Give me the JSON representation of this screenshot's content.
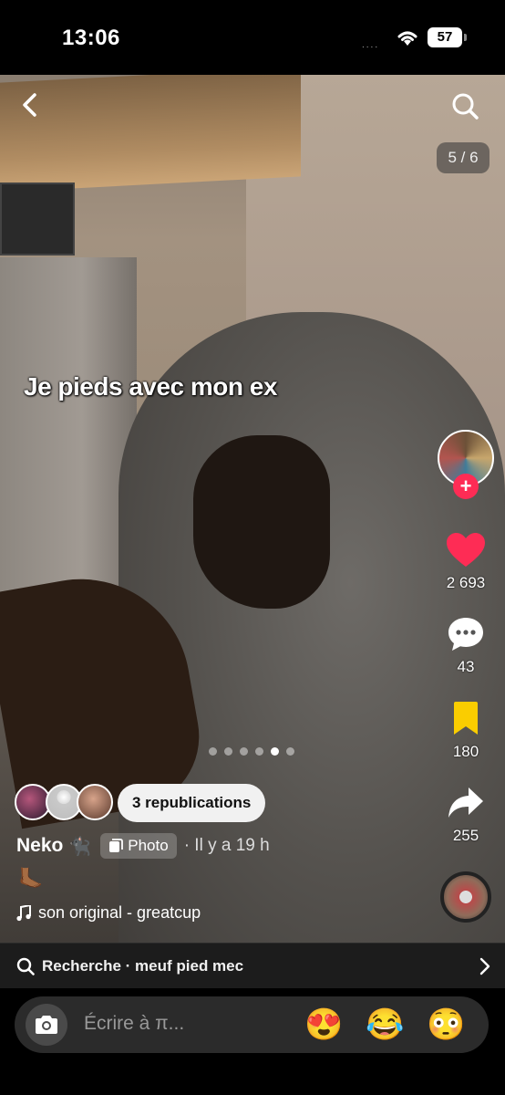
{
  "status_bar": {
    "time": "13:06",
    "signal": "....",
    "battery": "57"
  },
  "post": {
    "caption": "Je pieds avec mon ex",
    "counter": "5 / 6",
    "slides": {
      "total": 6,
      "active": 5
    }
  },
  "actions": {
    "likes": "2 693",
    "comments": "43",
    "saves": "180",
    "shares": "255",
    "like_color": "#fe2c55",
    "save_color": "#facd00",
    "follow_color": "#fe2c55"
  },
  "reposts": {
    "label": "3 republications"
  },
  "author": {
    "name": "Neko",
    "emoji": "🐈‍⬛",
    "badge": "Photo",
    "time": "· Il y a 19 h",
    "bio_emoji": "🦶🏾"
  },
  "music": {
    "label": "son original - greatcup"
  },
  "search_suggestion": {
    "label": "Recherche · meuf pied mec"
  },
  "comment_input": {
    "placeholder": "Écrire à π...",
    "emojis": [
      "😍",
      "😂",
      "😳"
    ]
  }
}
